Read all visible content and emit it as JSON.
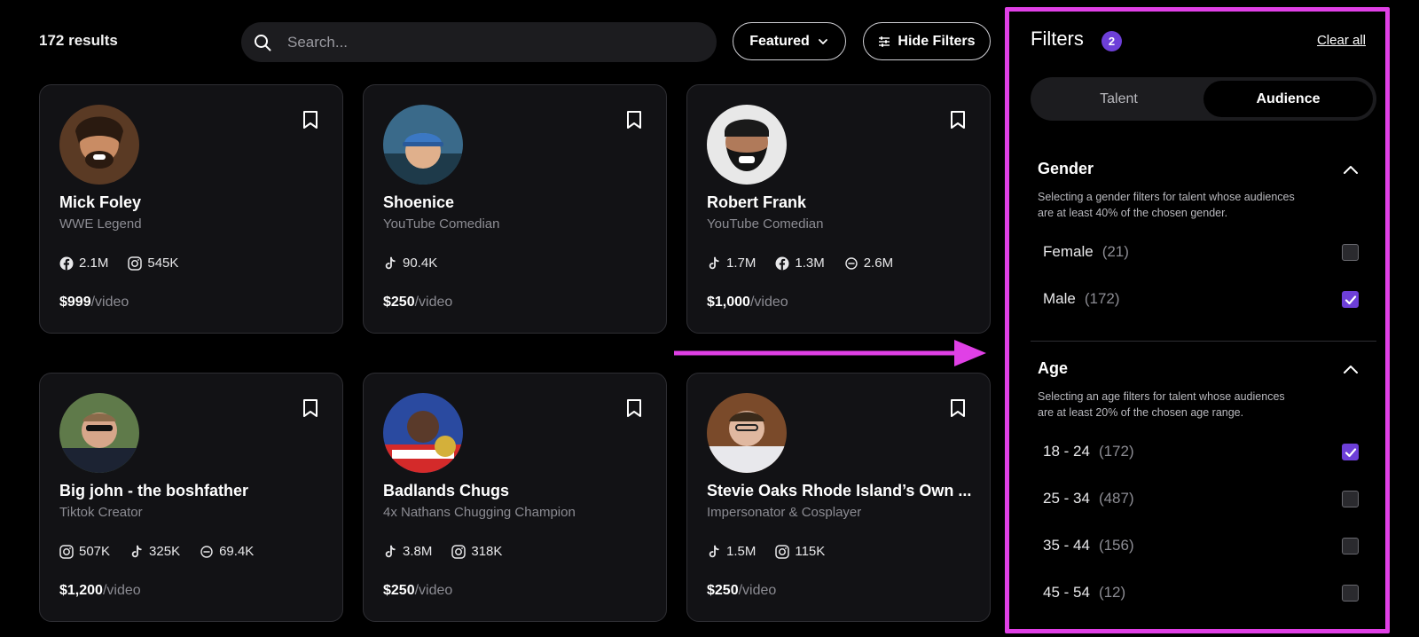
{
  "header": {
    "results_count": "172 results",
    "search_placeholder": "Search...",
    "sort_label": "Featured",
    "hide_filters_label": "Hide Filters"
  },
  "cards": [
    {
      "name": "Mick Foley",
      "role": "WWE Legend",
      "stats": [
        {
          "icon": "facebook-icon",
          "value": "2.1M"
        },
        {
          "icon": "instagram-icon",
          "value": "545K"
        }
      ],
      "price": "$999",
      "unit": "/video"
    },
    {
      "name": "Shoenice",
      "role": "YouTube Comedian",
      "stats": [
        {
          "icon": "tiktok-icon",
          "value": "90.4K"
        }
      ],
      "price": "$250",
      "unit": "/video"
    },
    {
      "name": "Robert Frank",
      "role": "YouTube Comedian",
      "stats": [
        {
          "icon": "tiktok-icon",
          "value": "1.7M"
        },
        {
          "icon": "facebook-icon",
          "value": "1.3M"
        },
        {
          "icon": "cameo-icon",
          "value": "2.6M"
        }
      ],
      "price": "$1,000",
      "unit": "/video"
    },
    {
      "name": "Big john - the boshfather",
      "role": "Tiktok Creator",
      "stats": [
        {
          "icon": "instagram-icon",
          "value": "507K"
        },
        {
          "icon": "tiktok-icon",
          "value": "325K"
        },
        {
          "icon": "cameo-icon",
          "value": "69.4K"
        }
      ],
      "price": "$1,200",
      "unit": "/video"
    },
    {
      "name": "Badlands Chugs",
      "role": "4x Nathans Chugging Champion",
      "stats": [
        {
          "icon": "tiktok-icon",
          "value": "3.8M"
        },
        {
          "icon": "instagram-icon",
          "value": "318K"
        }
      ],
      "price": "$250",
      "unit": "/video"
    },
    {
      "name": "Stevie Oaks Rhode Island’s Own ...",
      "role": "Impersonator & Cosplayer",
      "stats": [
        {
          "icon": "tiktok-icon",
          "value": "1.5M"
        },
        {
          "icon": "instagram-icon",
          "value": "115K"
        }
      ],
      "price": "$250",
      "unit": "/video"
    }
  ],
  "filters": {
    "title": "Filters",
    "badge": "2",
    "clear_all": "Clear all",
    "tabs": [
      {
        "label": "Talent",
        "active": false
      },
      {
        "label": "Audience",
        "active": true
      }
    ],
    "gender": {
      "title": "Gender",
      "desc_line1": "Selecting a gender filters for talent whose audiences",
      "desc_line2": "are at least 40% of the chosen gender.",
      "options": [
        {
          "label": "Female",
          "count": "(21)",
          "checked": false
        },
        {
          "label": "Male",
          "count": "(172)",
          "checked": true
        }
      ]
    },
    "age": {
      "title": "Age",
      "desc_line1": "Selecting an age filters for talent whose audiences",
      "desc_line2": "are at least 20% of the chosen age range.",
      "options": [
        {
          "label": "18 - 24",
          "count": "(172)",
          "checked": true
        },
        {
          "label": "25 - 34",
          "count": "(487)",
          "checked": false
        },
        {
          "label": "35 - 44",
          "count": "(156)",
          "checked": false
        },
        {
          "label": "45 - 54",
          "count": "(12)",
          "checked": false
        }
      ]
    }
  },
  "colors": {
    "accent": "#6d3fd8",
    "highlight": "#e040e6",
    "card_bg": "#121215"
  }
}
